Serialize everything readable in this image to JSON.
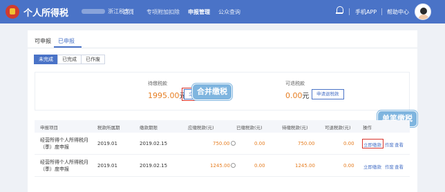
{
  "header": {
    "title": "个人所得税",
    "region": "浙江税务",
    "nav": [
      "首页",
      "专项附加扣除",
      "申报管理",
      "公众查询"
    ],
    "active_nav": "申报管理",
    "mobile_app": "手机APP",
    "help": "帮助中心",
    "colors": {
      "bar": "#4a73c7",
      "accent": "#4a73c7",
      "highlight": "#d8322a",
      "amount": "#e67e22"
    }
  },
  "tabs": {
    "items": [
      "可申报",
      "已申报"
    ],
    "active": "已申报"
  },
  "status_filter": {
    "items": [
      "未完成",
      "已完成",
      "已作废"
    ],
    "active": "未完成"
  },
  "summary": {
    "due_label": "待缴税款",
    "due_amount": "1995.00",
    "currency_unit": "元",
    "pay_now": "立即缴款",
    "refundable_label": "可退税款",
    "refundable_amount": "0.00",
    "refund_request": "申请退税款"
  },
  "annotations": {
    "merge_pay": "合并缴税",
    "single_pay": "单笔缴税"
  },
  "table": {
    "columns": [
      "申报项目",
      "税款所属期",
      "缴款期限",
      "应缴税款(元)",
      "已缴税款(元)",
      "待缴税款(元)",
      "可退税款(元)",
      "操作"
    ],
    "rows": [
      {
        "item": "经营所得个人所得税月（季）度申报",
        "period": "2019.01",
        "deadline": "2019.02.15",
        "payable": "750.00",
        "paid": "0.00",
        "outstanding": "750.00",
        "refundable": "0.00",
        "actions": [
          "立即缴款",
          "作废",
          "查看"
        ]
      },
      {
        "item": "经营所得个人所得税月（季）度申报",
        "period": "2019.01",
        "deadline": "2019.02.15",
        "payable": "1245.00",
        "paid": "0.00",
        "outstanding": "1245.00",
        "refundable": "0.00",
        "actions": [
          "立即缴款",
          "作废",
          "查看"
        ]
      }
    ]
  }
}
